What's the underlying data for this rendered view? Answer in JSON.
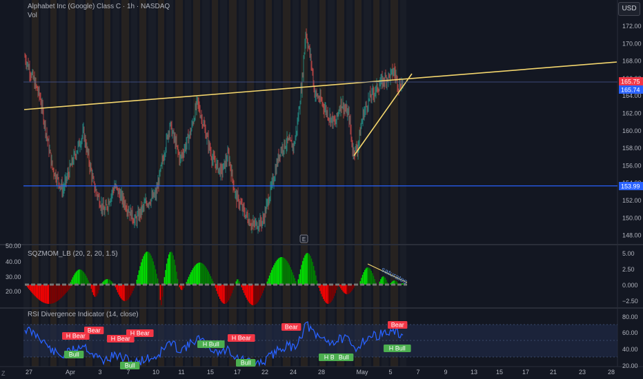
{
  "header": {
    "title": "Alphabet Inc (Google) Class C · 1h · NASDAQ",
    "vol_label": "Vol",
    "currency_button": "USD"
  },
  "panes": {
    "squeeze_title": "SQZMOM_LB (20, 2, 20, 1.5)",
    "rsi_title": "RSI Divergence Indicator (14, close)",
    "annotation_saturates": "saturates",
    "earnings_marker": "E"
  },
  "price_axis": {
    "ticks": [
      "172.00",
      "170.00",
      "168.00",
      "166.00",
      "164.00",
      "162.00",
      "160.00",
      "158.00",
      "156.00",
      "154.00",
      "152.00",
      "150.00",
      "148.00"
    ],
    "last_price": "165.75",
    "second_price": "165.74",
    "support_price": "153.99"
  },
  "squeeze_axis": {
    "ticks": [
      "5.00",
      "2.50",
      "0.000",
      "−2.50"
    ]
  },
  "rsi_axis": {
    "ticks": [
      "80.00",
      "60.00",
      "40.00",
      "20.00"
    ]
  },
  "vol_axis": {
    "ticks": [
      "50.00",
      "40.00",
      "30.00",
      "20.00"
    ]
  },
  "time_axis": {
    "labels": [
      "27",
      "Apr",
      "3",
      "7",
      "10",
      "11",
      "15",
      "17",
      "22",
      "24",
      "28",
      "May",
      "5",
      "7",
      "9",
      "13",
      "15",
      "17",
      "21",
      "23",
      "28"
    ],
    "timezone_icon_label": "Z"
  },
  "divergence_labels": [
    {
      "text": "H Bear",
      "kind": "bear"
    },
    {
      "text": "Bear",
      "kind": "bear"
    },
    {
      "text": "H Bear",
      "kind": "bear"
    },
    {
      "text": "H Bear",
      "kind": "bear"
    },
    {
      "text": "H Bear",
      "kind": "bear"
    },
    {
      "text": "Bear",
      "kind": "bear"
    },
    {
      "text": "Bear",
      "kind": "bear"
    },
    {
      "text": "Bull",
      "kind": "bull"
    },
    {
      "text": "Bull",
      "kind": "bull"
    },
    {
      "text": "H Bull",
      "kind": "bull"
    },
    {
      "text": "Bull",
      "kind": "bull"
    },
    {
      "text": "H Bull",
      "kind": "bull"
    },
    {
      "text": "Bull",
      "kind": "bull"
    },
    {
      "text": "H Bull",
      "kind": "bull"
    }
  ],
  "colors": {
    "background": "#131722",
    "up_candle": "#26a69a",
    "down_candle": "#ef5350",
    "trendline": "#f5d76e",
    "support_line": "#2962ff",
    "price_label_red": "#f23645",
    "price_label_blue": "#2962ff",
    "sqz_green": "#00e600",
    "sqz_dark_green": "#008000",
    "sqz_red": "#ff0000",
    "sqz_dark_red": "#800000",
    "rsi_line": "#2962ff",
    "bear_label": "#f23645",
    "bull_label": "#4caf50"
  }
}
